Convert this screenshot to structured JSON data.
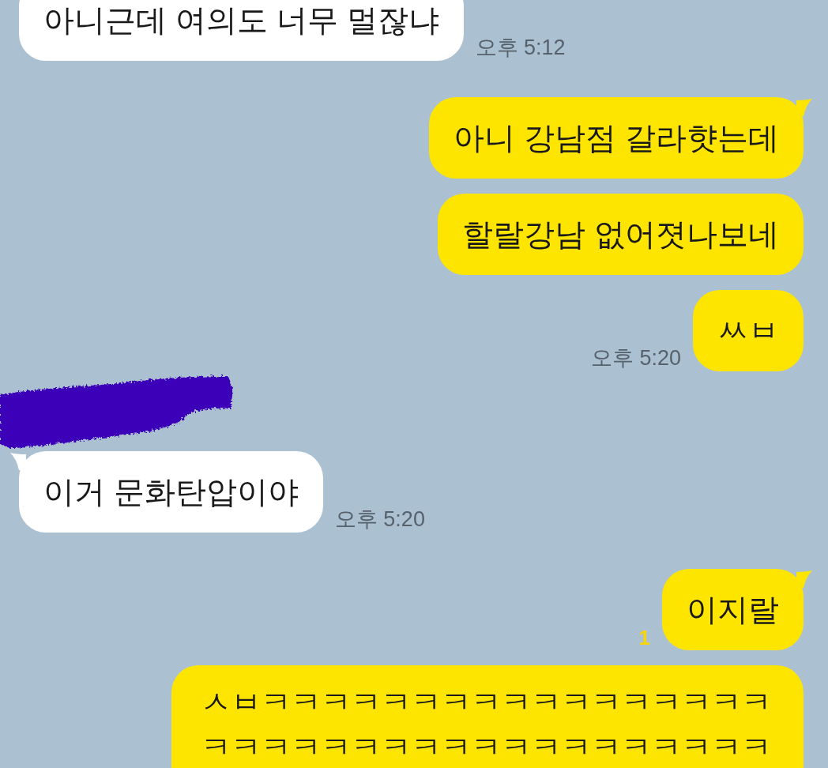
{
  "chat": [
    {
      "kind": "received",
      "tail": false,
      "text": "아니근데 여의도 너무 멀잖냐",
      "time": "오후 5:12"
    },
    {
      "kind": "sent",
      "tail": true,
      "text": "아니 강남점 갈라햣는데"
    },
    {
      "kind": "sent",
      "tail": false,
      "text": "할랄강남 없어졋나보네"
    },
    {
      "kind": "sent",
      "tail": false,
      "text": "ㅆㅂ",
      "time": "오후 5:20"
    },
    {
      "kind": "redacted_name"
    },
    {
      "kind": "received",
      "tail": true,
      "text": "이거 문화탄압이야",
      "time": "오후 5:20"
    },
    {
      "kind": "sent",
      "tail": true,
      "text": "이지랄",
      "unread": "1"
    },
    {
      "kind": "sent",
      "tail": false,
      "text": "ㅅㅂㅋㅋㅋㅋㅋㅋㅋㅋㅋㅋㅋㅋㅋㅋㅋㅋㅋㅋㅋㅋㅋㅋㅋㅋㅋㅋㅋㅋㅋㅋㅋㅋㅋㅋㅋㅋ"
    }
  ]
}
